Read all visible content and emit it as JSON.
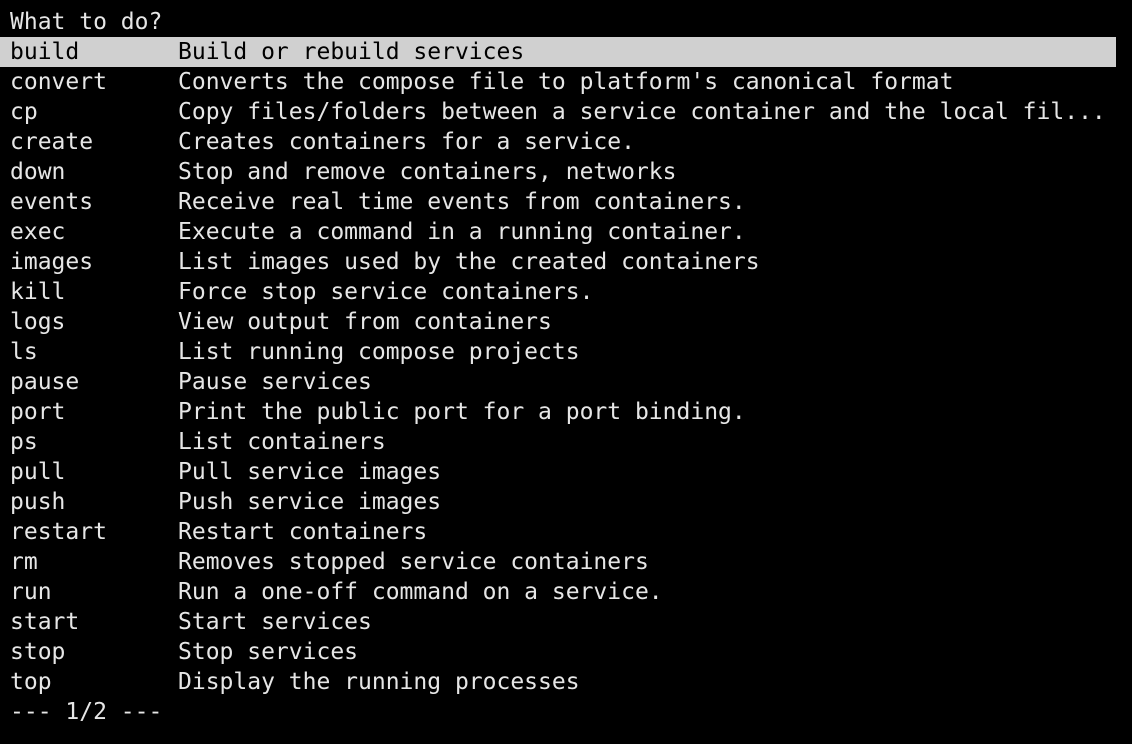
{
  "prompt": "What to do?",
  "selected_index": 0,
  "menu": [
    {
      "command": "build",
      "description": "Build or rebuild services"
    },
    {
      "command": "convert",
      "description": "Converts the compose file to platform's canonical format"
    },
    {
      "command": "cp",
      "description": "Copy files/folders between a service container and the local fil..."
    },
    {
      "command": "create",
      "description": "Creates containers for a service."
    },
    {
      "command": "down",
      "description": "Stop and remove containers, networks"
    },
    {
      "command": "events",
      "description": "Receive real time events from containers."
    },
    {
      "command": "exec",
      "description": "Execute a command in a running container."
    },
    {
      "command": "images",
      "description": "List images used by the created containers"
    },
    {
      "command": "kill",
      "description": "Force stop service containers."
    },
    {
      "command": "logs",
      "description": "View output from containers"
    },
    {
      "command": "ls",
      "description": "List running compose projects"
    },
    {
      "command": "pause",
      "description": "Pause services"
    },
    {
      "command": "port",
      "description": "Print the public port for a port binding."
    },
    {
      "command": "ps",
      "description": "List containers"
    },
    {
      "command": "pull",
      "description": "Pull service images"
    },
    {
      "command": "push",
      "description": "Push service images"
    },
    {
      "command": "restart",
      "description": "Restart containers"
    },
    {
      "command": "rm",
      "description": "Removes stopped service containers"
    },
    {
      "command": "run",
      "description": "Run a one-off command on a service."
    },
    {
      "command": "start",
      "description": "Start services"
    },
    {
      "command": "stop",
      "description": "Stop services"
    },
    {
      "command": "top",
      "description": "Display the running processes"
    }
  ],
  "pager": "--- 1/2 ---",
  "colors": {
    "background": "#000000",
    "foreground": "#e6e6e6",
    "highlight_bg": "#d0d0d0",
    "highlight_fg": "#000000"
  }
}
